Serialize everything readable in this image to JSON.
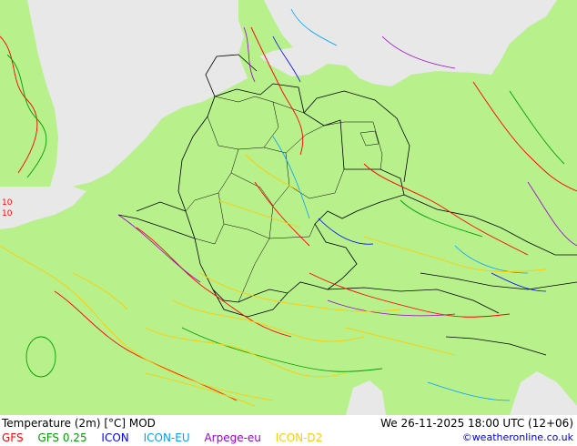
{
  "title": "Temperature (2m) [°C] MOD",
  "datetime": "We 26-11-2025 18:00 UTC (12+06)",
  "credit": "©weatheronline.co.uk",
  "legend": [
    {
      "label": "GFS",
      "color": "#ff0000"
    },
    {
      "label": "GFS 0.25",
      "color": "#00a000"
    },
    {
      "label": "ICON",
      "color": "#0000ff"
    },
    {
      "label": "ICON-EU",
      "color": "#00a0ff"
    },
    {
      "label": "Arpege-eu",
      "color": "#9900cc"
    },
    {
      "label": "ICON-D2",
      "color": "#ffcc00"
    }
  ],
  "map_labels": [
    "10",
    "10"
  ],
  "colors": {
    "land": "#b8f08c",
    "sea": "#e8e8e8",
    "border": "#000000",
    "gfs": "#ff0000",
    "gfs025": "#00a000",
    "icon": "#0000ff",
    "iconeu": "#00a0ff",
    "arpege": "#9900cc",
    "icond2": "#ffcc00"
  }
}
